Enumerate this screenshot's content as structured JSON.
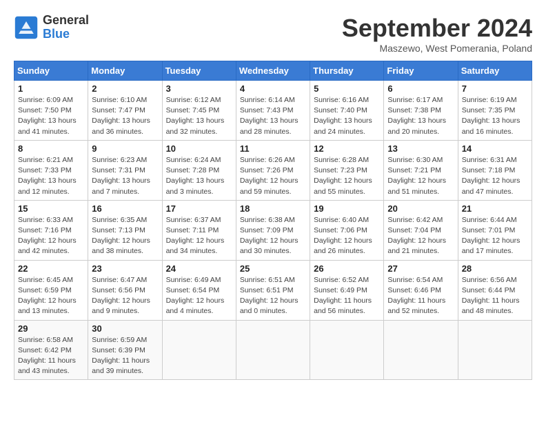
{
  "header": {
    "logo_general": "General",
    "logo_blue": "Blue",
    "month_title": "September 2024",
    "subtitle": "Maszewo, West Pomerania, Poland"
  },
  "weekdays": [
    "Sunday",
    "Monday",
    "Tuesday",
    "Wednesday",
    "Thursday",
    "Friday",
    "Saturday"
  ],
  "weeks": [
    [
      {
        "day": "1",
        "info": "Sunrise: 6:09 AM\nSunset: 7:50 PM\nDaylight: 13 hours\nand 41 minutes."
      },
      {
        "day": "2",
        "info": "Sunrise: 6:10 AM\nSunset: 7:47 PM\nDaylight: 13 hours\nand 36 minutes."
      },
      {
        "day": "3",
        "info": "Sunrise: 6:12 AM\nSunset: 7:45 PM\nDaylight: 13 hours\nand 32 minutes."
      },
      {
        "day": "4",
        "info": "Sunrise: 6:14 AM\nSunset: 7:43 PM\nDaylight: 13 hours\nand 28 minutes."
      },
      {
        "day": "5",
        "info": "Sunrise: 6:16 AM\nSunset: 7:40 PM\nDaylight: 13 hours\nand 24 minutes."
      },
      {
        "day": "6",
        "info": "Sunrise: 6:17 AM\nSunset: 7:38 PM\nDaylight: 13 hours\nand 20 minutes."
      },
      {
        "day": "7",
        "info": "Sunrise: 6:19 AM\nSunset: 7:35 PM\nDaylight: 13 hours\nand 16 minutes."
      }
    ],
    [
      {
        "day": "8",
        "info": "Sunrise: 6:21 AM\nSunset: 7:33 PM\nDaylight: 13 hours\nand 12 minutes."
      },
      {
        "day": "9",
        "info": "Sunrise: 6:23 AM\nSunset: 7:31 PM\nDaylight: 13 hours\nand 7 minutes."
      },
      {
        "day": "10",
        "info": "Sunrise: 6:24 AM\nSunset: 7:28 PM\nDaylight: 13 hours\nand 3 minutes."
      },
      {
        "day": "11",
        "info": "Sunrise: 6:26 AM\nSunset: 7:26 PM\nDaylight: 12 hours\nand 59 minutes."
      },
      {
        "day": "12",
        "info": "Sunrise: 6:28 AM\nSunset: 7:23 PM\nDaylight: 12 hours\nand 55 minutes."
      },
      {
        "day": "13",
        "info": "Sunrise: 6:30 AM\nSunset: 7:21 PM\nDaylight: 12 hours\nand 51 minutes."
      },
      {
        "day": "14",
        "info": "Sunrise: 6:31 AM\nSunset: 7:18 PM\nDaylight: 12 hours\nand 47 minutes."
      }
    ],
    [
      {
        "day": "15",
        "info": "Sunrise: 6:33 AM\nSunset: 7:16 PM\nDaylight: 12 hours\nand 42 minutes."
      },
      {
        "day": "16",
        "info": "Sunrise: 6:35 AM\nSunset: 7:13 PM\nDaylight: 12 hours\nand 38 minutes."
      },
      {
        "day": "17",
        "info": "Sunrise: 6:37 AM\nSunset: 7:11 PM\nDaylight: 12 hours\nand 34 minutes."
      },
      {
        "day": "18",
        "info": "Sunrise: 6:38 AM\nSunset: 7:09 PM\nDaylight: 12 hours\nand 30 minutes."
      },
      {
        "day": "19",
        "info": "Sunrise: 6:40 AM\nSunset: 7:06 PM\nDaylight: 12 hours\nand 26 minutes."
      },
      {
        "day": "20",
        "info": "Sunrise: 6:42 AM\nSunset: 7:04 PM\nDaylight: 12 hours\nand 21 minutes."
      },
      {
        "day": "21",
        "info": "Sunrise: 6:44 AM\nSunset: 7:01 PM\nDaylight: 12 hours\nand 17 minutes."
      }
    ],
    [
      {
        "day": "22",
        "info": "Sunrise: 6:45 AM\nSunset: 6:59 PM\nDaylight: 12 hours\nand 13 minutes."
      },
      {
        "day": "23",
        "info": "Sunrise: 6:47 AM\nSunset: 6:56 PM\nDaylight: 12 hours\nand 9 minutes."
      },
      {
        "day": "24",
        "info": "Sunrise: 6:49 AM\nSunset: 6:54 PM\nDaylight: 12 hours\nand 4 minutes."
      },
      {
        "day": "25",
        "info": "Sunrise: 6:51 AM\nSunset: 6:51 PM\nDaylight: 12 hours\nand 0 minutes."
      },
      {
        "day": "26",
        "info": "Sunrise: 6:52 AM\nSunset: 6:49 PM\nDaylight: 11 hours\nand 56 minutes."
      },
      {
        "day": "27",
        "info": "Sunrise: 6:54 AM\nSunset: 6:46 PM\nDaylight: 11 hours\nand 52 minutes."
      },
      {
        "day": "28",
        "info": "Sunrise: 6:56 AM\nSunset: 6:44 PM\nDaylight: 11 hours\nand 48 minutes."
      }
    ],
    [
      {
        "day": "29",
        "info": "Sunrise: 6:58 AM\nSunset: 6:42 PM\nDaylight: 11 hours\nand 43 minutes."
      },
      {
        "day": "30",
        "info": "Sunrise: 6:59 AM\nSunset: 6:39 PM\nDaylight: 11 hours\nand 39 minutes."
      },
      {
        "day": "",
        "info": ""
      },
      {
        "day": "",
        "info": ""
      },
      {
        "day": "",
        "info": ""
      },
      {
        "day": "",
        "info": ""
      },
      {
        "day": "",
        "info": ""
      }
    ]
  ]
}
